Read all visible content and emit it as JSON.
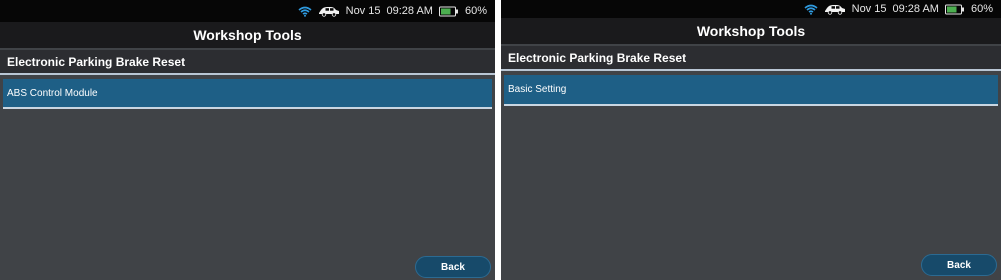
{
  "screens": [
    {
      "status": {
        "date": "Nov 15",
        "time": "09:28 AM",
        "battery": "60%"
      },
      "title": "Workshop Tools",
      "section_header": "Electronic Parking Brake Reset",
      "list_item": "ABS Control Module",
      "back_label": "Back"
    },
    {
      "status": {
        "date": "Nov 15",
        "time": "09:28 AM",
        "battery": "60%"
      },
      "title": "Workshop Tools",
      "section_header": "Electronic Parking Brake Reset",
      "list_item": "Basic Setting",
      "back_label": "Back"
    }
  ],
  "icons": {
    "wifi": "wifi-icon",
    "vehicle": "car-icon",
    "battery": "battery-icon"
  },
  "colors": {
    "screen_background": "#404347",
    "title_bar": "#1a1a1c",
    "status_bar": "#060606",
    "section_header": "#2c2d31",
    "selected_item": "#1e5f86",
    "back_button": "#174a6a",
    "battery_fill": "#4caf50",
    "wifi": "#2f9be0"
  }
}
